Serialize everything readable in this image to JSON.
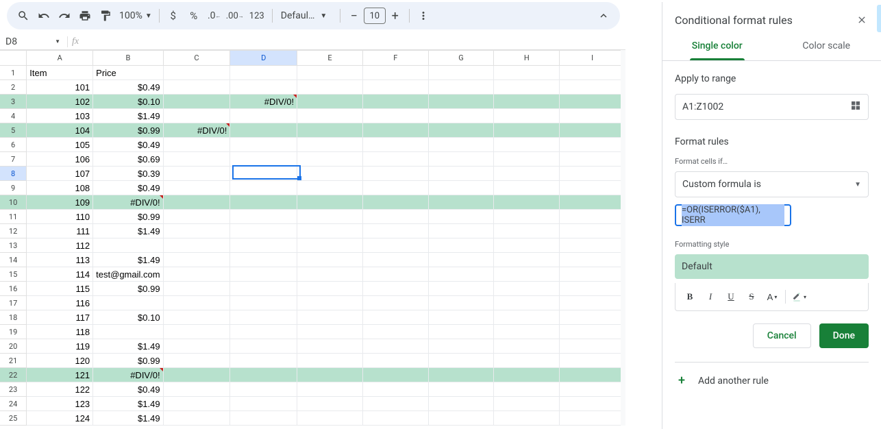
{
  "toolbar": {
    "zoom": "100%",
    "font": "Defaul…",
    "fontsize": "10",
    "currency": "$",
    "percent": "%",
    "numfmt": "123"
  },
  "namebox": {
    "ref": "D8"
  },
  "columns": [
    "A",
    "B",
    "C",
    "D",
    "E",
    "F",
    "G",
    "H",
    "I"
  ],
  "selected_col": "D",
  "selected_row_idx": 8,
  "rows": [
    {
      "n": 1,
      "hl": false,
      "cells": {
        "A": {
          "v": "Item",
          "a": "l"
        },
        "B": {
          "v": "Price",
          "a": "l"
        }
      }
    },
    {
      "n": 2,
      "hl": false,
      "cells": {
        "A": {
          "v": "101",
          "a": "r"
        },
        "B": {
          "v": "$0.49",
          "a": "r"
        }
      }
    },
    {
      "n": 3,
      "hl": true,
      "cells": {
        "A": {
          "v": "102",
          "a": "r"
        },
        "B": {
          "v": "$0.10",
          "a": "r"
        },
        "D": {
          "v": "#DIV/0!",
          "a": "r",
          "err": true
        }
      }
    },
    {
      "n": 4,
      "hl": false,
      "cells": {
        "A": {
          "v": "103",
          "a": "r"
        },
        "B": {
          "v": "$1.49",
          "a": "r"
        }
      }
    },
    {
      "n": 5,
      "hl": true,
      "cells": {
        "A": {
          "v": "104",
          "a": "r"
        },
        "B": {
          "v": "$0.99",
          "a": "r"
        },
        "C": {
          "v": "#DIV/0!",
          "a": "r",
          "err": true
        }
      }
    },
    {
      "n": 6,
      "hl": false,
      "cells": {
        "A": {
          "v": "105",
          "a": "r"
        },
        "B": {
          "v": "$0.49",
          "a": "r"
        }
      }
    },
    {
      "n": 7,
      "hl": false,
      "cells": {
        "A": {
          "v": "106",
          "a": "r"
        },
        "B": {
          "v": "$0.69",
          "a": "r"
        }
      }
    },
    {
      "n": 8,
      "hl": false,
      "cells": {
        "A": {
          "v": "107",
          "a": "r"
        },
        "B": {
          "v": "$0.39",
          "a": "r"
        }
      }
    },
    {
      "n": 9,
      "hl": false,
      "cells": {
        "A": {
          "v": "108",
          "a": "r"
        },
        "B": {
          "v": "$0.49",
          "a": "r"
        }
      }
    },
    {
      "n": 10,
      "hl": true,
      "cells": {
        "A": {
          "v": "109",
          "a": "r"
        },
        "B": {
          "v": "#DIV/0!",
          "a": "r",
          "err": true
        }
      }
    },
    {
      "n": 11,
      "hl": false,
      "cells": {
        "A": {
          "v": "110",
          "a": "r"
        },
        "B": {
          "v": "$0.99",
          "a": "r"
        }
      }
    },
    {
      "n": 12,
      "hl": false,
      "cells": {
        "A": {
          "v": "111",
          "a": "r"
        },
        "B": {
          "v": "$1.49",
          "a": "r"
        }
      }
    },
    {
      "n": 13,
      "hl": false,
      "cells": {
        "A": {
          "v": "112",
          "a": "r"
        }
      }
    },
    {
      "n": 14,
      "hl": false,
      "cells": {
        "A": {
          "v": "113",
          "a": "r"
        },
        "B": {
          "v": "$1.49",
          "a": "r"
        }
      }
    },
    {
      "n": 15,
      "hl": false,
      "cells": {
        "A": {
          "v": "114",
          "a": "r"
        },
        "B": {
          "v": "test@gmail.com",
          "a": "l"
        }
      }
    },
    {
      "n": 16,
      "hl": false,
      "cells": {
        "A": {
          "v": "115",
          "a": "r"
        },
        "B": {
          "v": "$0.99",
          "a": "r"
        }
      }
    },
    {
      "n": 17,
      "hl": false,
      "cells": {
        "A": {
          "v": "116",
          "a": "r"
        }
      }
    },
    {
      "n": 18,
      "hl": false,
      "cells": {
        "A": {
          "v": "117",
          "a": "r"
        },
        "B": {
          "v": "$0.10",
          "a": "r"
        }
      }
    },
    {
      "n": 19,
      "hl": false,
      "cells": {
        "A": {
          "v": "118",
          "a": "r"
        }
      }
    },
    {
      "n": 20,
      "hl": false,
      "cells": {
        "A": {
          "v": "119",
          "a": "r"
        },
        "B": {
          "v": "$1.49",
          "a": "r"
        }
      }
    },
    {
      "n": 21,
      "hl": false,
      "cells": {
        "A": {
          "v": "120",
          "a": "r"
        },
        "B": {
          "v": "$0.99",
          "a": "r"
        }
      }
    },
    {
      "n": 22,
      "hl": true,
      "cells": {
        "A": {
          "v": "121",
          "a": "r"
        },
        "B": {
          "v": "#DIV/0!",
          "a": "r",
          "err": true
        }
      }
    },
    {
      "n": 23,
      "hl": false,
      "cells": {
        "A": {
          "v": "122",
          "a": "r"
        },
        "B": {
          "v": "$0.49",
          "a": "r"
        }
      }
    },
    {
      "n": 24,
      "hl": false,
      "cells": {
        "A": {
          "v": "123",
          "a": "r"
        },
        "B": {
          "v": "$1.49",
          "a": "r"
        }
      }
    },
    {
      "n": 25,
      "hl": false,
      "cells": {
        "A": {
          "v": "124",
          "a": "r"
        },
        "B": {
          "v": "$1.49",
          "a": "r"
        }
      }
    }
  ],
  "panel": {
    "title": "Conditional format rules",
    "tabs": {
      "single": "Single color",
      "scale": "Color scale"
    },
    "apply_label": "Apply to range",
    "range": "A1:Z1002",
    "rules_label": "Format rules",
    "cells_if_label": "Format cells if…",
    "condition": "Custom formula is",
    "formula": "=OR(ISERROR($A1), ISERR",
    "style_label": "Formatting style",
    "style_name": "Default",
    "cancel": "Cancel",
    "done": "Done",
    "add_rule": "Add another rule"
  }
}
